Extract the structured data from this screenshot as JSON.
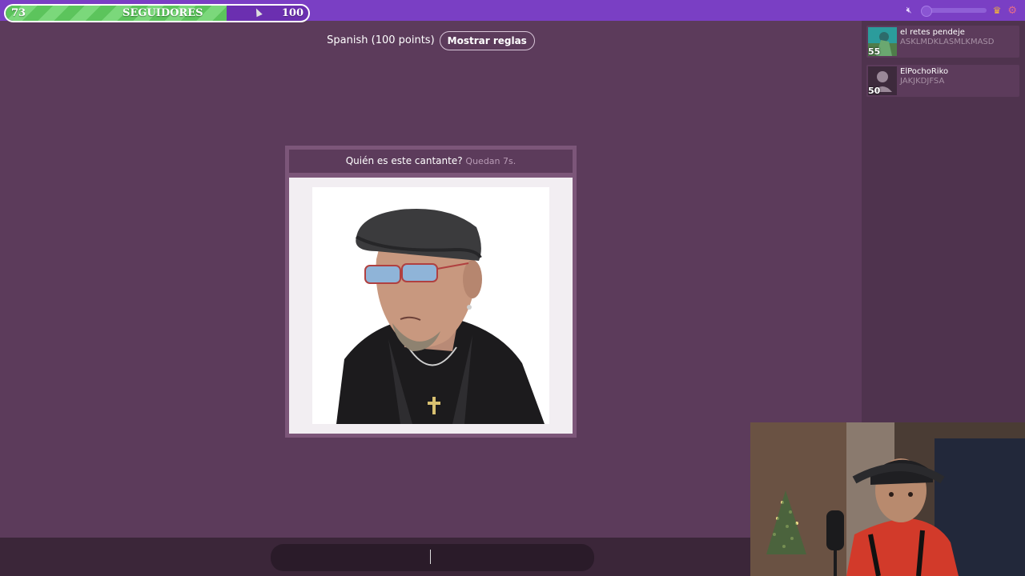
{
  "followers": {
    "current": "73",
    "label": "SEGUIDORES",
    "goal": "100",
    "progress": 0.73
  },
  "header": {
    "language": "Spanish (100 points)",
    "rules_button": "Mostrar reglas"
  },
  "question": {
    "prompt": "Quién es este cantante?",
    "timer": "Quedan 7s."
  },
  "players": [
    {
      "name": "el retes pendeje",
      "status": "ASKLMDKLASMLKMASD",
      "score": "55"
    },
    {
      "name": "ElPochoRiko",
      "status": "JAKJKDJFSA",
      "score": "50"
    }
  ],
  "answer": {
    "value": "",
    "placeholder": ""
  },
  "icons": {
    "mute": "mute-icon",
    "crown": "crown-icon",
    "gear": "gear-icon"
  },
  "colors": {
    "background": "#5c3b5b",
    "topbar": "#7a3fc4",
    "progress": "#5cc45c"
  }
}
